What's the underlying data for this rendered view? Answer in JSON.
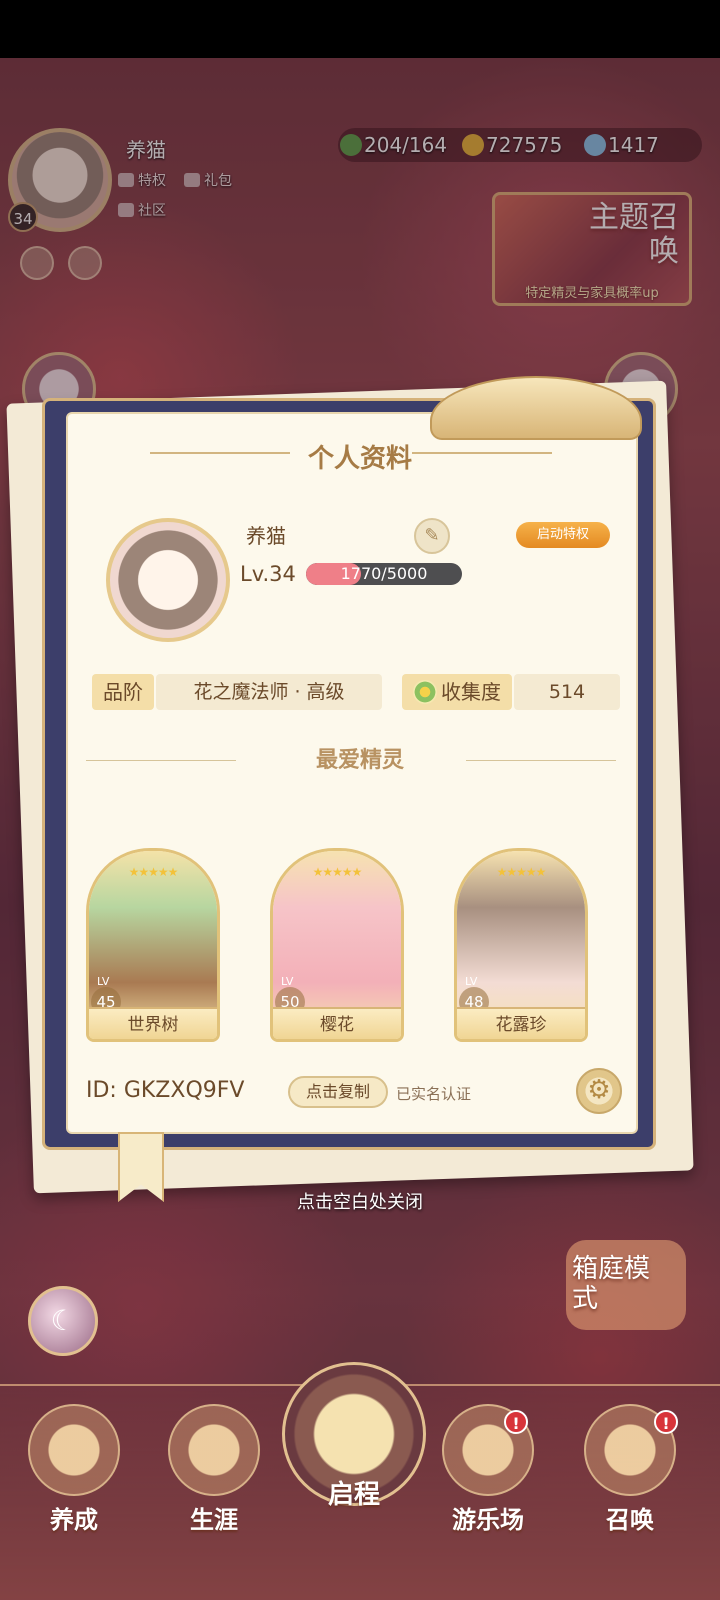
{
  "hud": {
    "player_name": "养猫",
    "player_level": "34",
    "links": {
      "privilege": "特权",
      "gift": "礼包",
      "community": "社区"
    }
  },
  "currencies": {
    "stamina": "204/164",
    "gold": "727575",
    "gems": "1417"
  },
  "summon_banner": {
    "title": "主题召唤",
    "subtitle": "特定精灵与家具概率up"
  },
  "profile": {
    "title": "个人资料",
    "name": "养猫",
    "level_label": "Lv.34",
    "xp_text": "1770/5000",
    "xp_fraction": 0.354,
    "privilege_button": "启动特权",
    "rank_label": "品阶",
    "rank_value": "花之魔法师 · 高级",
    "collection_label": "收集度",
    "collection_value": "514",
    "favorites_title": "最爱精灵",
    "favorites": [
      {
        "name": "世界树",
        "lv_label": "LV",
        "level": "45",
        "stars": "★★★★★"
      },
      {
        "name": "樱花",
        "lv_label": "LV",
        "level": "50",
        "stars": "★★★★★"
      },
      {
        "name": "花露珍",
        "lv_label": "LV",
        "level": "48",
        "stars": "★★★★★"
      }
    ],
    "id_text": "ID:  GKZXQ9FV",
    "copy_button": "点击复制",
    "verified_text": "已实名认证"
  },
  "close_hint": "点击空白处关闭",
  "garden_mode": "箱庭模式",
  "nav": {
    "nurture": "养成",
    "career": "生涯",
    "journey": "启程",
    "playground": "游乐场",
    "summon": "召唤",
    "badge_text": "!"
  },
  "colors": {
    "accent_gold": "#d5b27a",
    "panel_bg": "#fdf9ec",
    "xp_fill": "#ef7f88",
    "privilege_orange": "#e48a22",
    "badge_red": "#d8343a"
  }
}
